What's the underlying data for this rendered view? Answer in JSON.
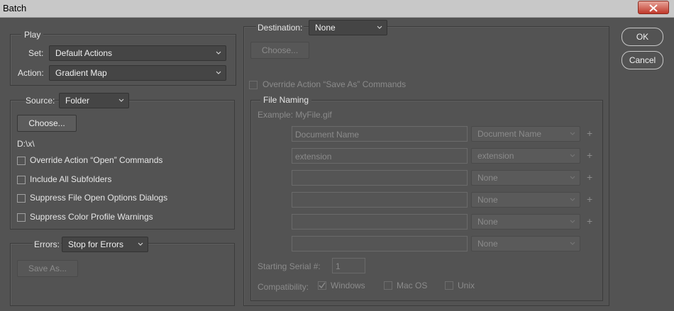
{
  "window": {
    "title": "Batch"
  },
  "buttons": {
    "ok": "OK",
    "cancel": "Cancel"
  },
  "play": {
    "legend": "Play",
    "set_label": "Set:",
    "set_value": "Default Actions",
    "action_label": "Action:",
    "action_value": "Gradient Map"
  },
  "source": {
    "label": "Source:",
    "value": "Folder",
    "choose": "Choose...",
    "path": "D:\\x\\",
    "options": [
      "Override Action “Open” Commands",
      "Include All Subfolders",
      "Suppress File Open Options Dialogs",
      "Suppress Color Profile Warnings"
    ]
  },
  "errors": {
    "label": "Errors:",
    "value": "Stop for Errors",
    "save_as": "Save As..."
  },
  "destination": {
    "label": "Destination:",
    "value": "None",
    "choose": "Choose...",
    "override": "Override Action “Save As” Commands"
  },
  "file_naming": {
    "legend": "File Naming",
    "example": "Example: MyFile.gif",
    "rows": [
      {
        "input": "Document Name",
        "select": "Document Name"
      },
      {
        "input": "extension",
        "select": "extension"
      },
      {
        "input": "",
        "select": "None"
      },
      {
        "input": "",
        "select": "None"
      },
      {
        "input": "",
        "select": "None"
      },
      {
        "input": "",
        "select": "None"
      }
    ],
    "plus": "+",
    "serial_label": "Starting Serial #:",
    "serial_value": "1",
    "compat_label": "Compatibility:",
    "compat": [
      {
        "label": "Windows",
        "checked": true
      },
      {
        "label": "Mac OS",
        "checked": false
      },
      {
        "label": "Unix",
        "checked": false
      }
    ]
  }
}
